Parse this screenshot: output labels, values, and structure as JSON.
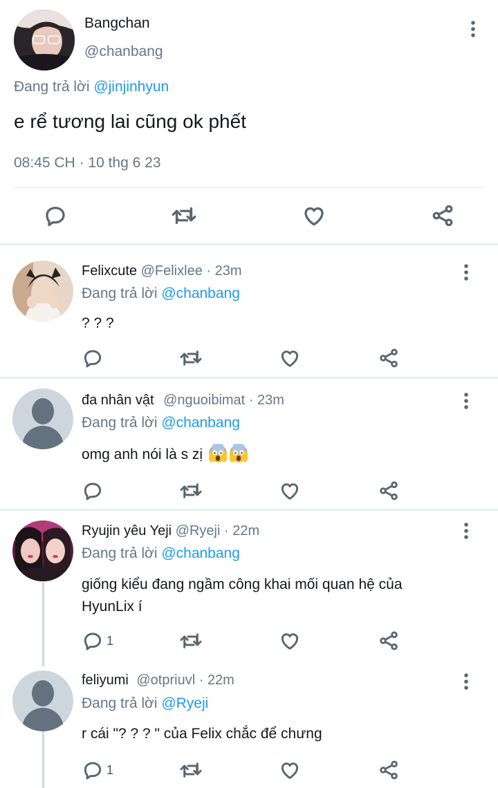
{
  "main_tweet": {
    "name": "Bangchan",
    "handle": "@chanbang",
    "reply_prefix": "Đang trả lời",
    "reply_to": "@jinjinhyun",
    "text": "e rể tương lai cũng ok phết",
    "time": "08:45 CH",
    "date": "10 thg 6 23"
  },
  "replies": [
    {
      "name": "Felixcute",
      "handle": "@Felixlee",
      "age": "23m",
      "reply_prefix": "Đang trả lời",
      "reply_to": "@chanbang",
      "text": "? ? ?",
      "reply_count": ""
    },
    {
      "name": "đa nhân vật",
      "handle": "@nguoibimat",
      "age": "23m",
      "reply_prefix": "Đang trả lời",
      "reply_to": "@chanbang",
      "text": "omg anh nói là s zị",
      "emoji": [
        "face-screaming-in-fear",
        "face-screaming-in-fear"
      ],
      "reply_count": ""
    },
    {
      "name": "Ryujin yêu Yeji",
      "handle": "@Ryeji",
      "age": "22m",
      "reply_prefix": "Đang trả lời",
      "reply_to": "@chanbang",
      "text_line1": "giống kiểu đang ngầm công khai mối quan hệ của",
      "text_line2": "HyunLix í",
      "reply_count": "1"
    },
    {
      "name": "feliyumi",
      "handle": "@otpriuvl",
      "age": "22m",
      "reply_prefix": "Đang trả lời",
      "reply_to": "@Ryeji",
      "text": "r cái \"? ? ? \" của Felix chắc để chưng",
      "reply_count": "1"
    }
  ],
  "icons": {
    "reply": "reply-bubble-icon",
    "retweet": "retweet-icon",
    "like": "heart-icon",
    "share": "share-icon",
    "more": "more-vertical-icon"
  },
  "colors": {
    "link": "#1d9bf0",
    "secondary_text": "#657786",
    "icon": "#5b6670",
    "divider": "#e8edf1"
  }
}
